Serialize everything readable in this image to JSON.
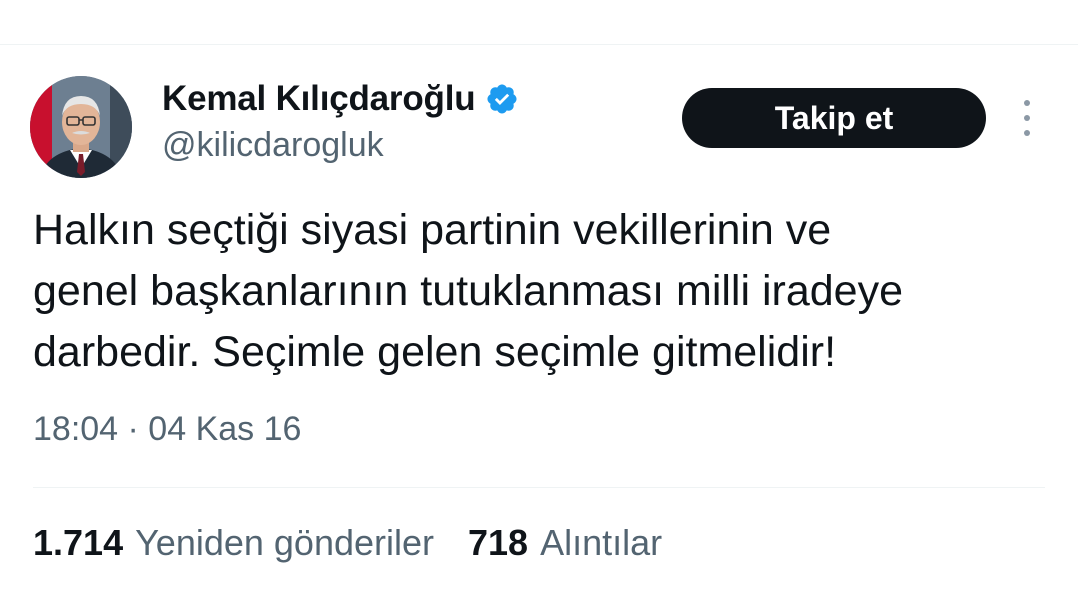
{
  "author": {
    "display_name": "Kemal Kılıçdaroğlu",
    "handle": "@kilicdarogluk",
    "verified": true
  },
  "actions": {
    "follow_label": "Takip et"
  },
  "tweet": {
    "text": "Halkın seçtiği siyasi partinin vekillerinin ve\ngenel başkanlarının tutuklanması milli iradeye\ndarbedir. Seçimle gelen seçimle gitmelidir!",
    "timestamp": "18:04 · 04 Kas 16"
  },
  "stats": [
    {
      "count": "1.714",
      "label": "Yeniden gönderiler"
    },
    {
      "count": "718",
      "label": "Alıntılar"
    }
  ],
  "colors": {
    "verified_badge": "#1d9bf0",
    "follow_button_bg": "#0f1419",
    "secondary_text": "#536471"
  },
  "icons": {
    "verified": "verified-badge-icon",
    "more": "more-options-icon"
  }
}
